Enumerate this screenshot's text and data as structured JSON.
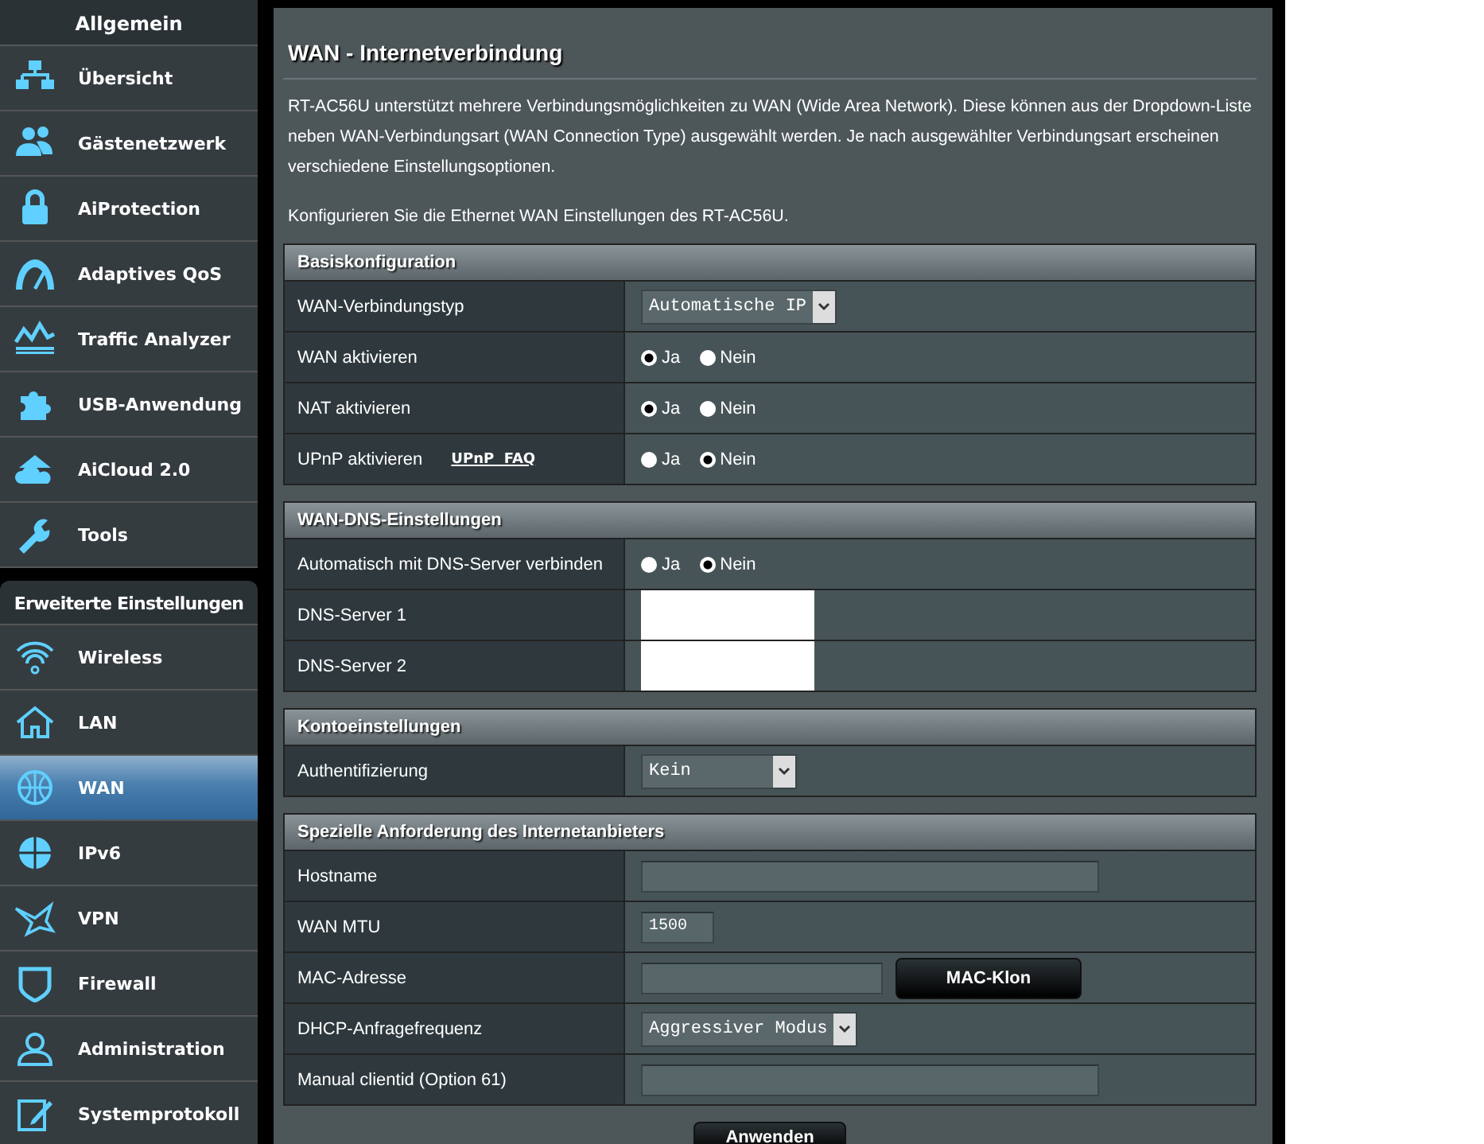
{
  "sidebar": {
    "groups": [
      {
        "title": "Allgemein",
        "items": [
          {
            "label": "Übersicht",
            "selected": false
          },
          {
            "label": "Gästenetzwerk",
            "selected": false
          },
          {
            "label": "AiProtection",
            "selected": false
          },
          {
            "label": "Adaptives QoS",
            "selected": false
          },
          {
            "label": "Traffic Analyzer",
            "selected": false
          },
          {
            "label": "USB-Anwendung",
            "selected": false
          },
          {
            "label": "AiCloud 2.0",
            "selected": false
          },
          {
            "label": "Tools",
            "selected": false
          }
        ]
      },
      {
        "title": "Erweiterte Einstellungen",
        "items": [
          {
            "label": "Wireless",
            "selected": false
          },
          {
            "label": "LAN",
            "selected": false
          },
          {
            "label": "WAN",
            "selected": true
          },
          {
            "label": "IPv6",
            "selected": false
          },
          {
            "label": "VPN",
            "selected": false
          },
          {
            "label": "Firewall",
            "selected": false
          },
          {
            "label": "Administration",
            "selected": false
          },
          {
            "label": "Systemprotokoll",
            "selected": false
          }
        ]
      }
    ]
  },
  "page": {
    "title": "WAN - Internetverbindung",
    "description": "RT-AC56U unterstützt mehrere Verbindungsmöglichkeiten zu WAN (Wide Area Network). Diese können aus der Dropdown-Liste neben WAN-Verbindungsart (WAN Connection Type) ausgewählt werden. Je nach ausgewählter Verbindungsart erscheinen verschiedene Einstellungsoptionen.",
    "note": "Konfigurieren Sie die Ethernet WAN Einstellungen des RT-AC56U.",
    "sections": [
      {
        "title": "Basiskonfiguration",
        "rows": [
          {
            "label": "WAN-Verbindungstyp",
            "kind": "select",
            "value": "Automatische IP"
          },
          {
            "label": "WAN aktivieren",
            "kind": "radio",
            "options": [
              {
                "label": "Ja",
                "selected": true
              },
              {
                "label": "Nein",
                "selected": false
              }
            ]
          },
          {
            "label": "NAT aktivieren",
            "kind": "radio",
            "options": [
              {
                "label": "Ja",
                "selected": true
              },
              {
                "label": "Nein",
                "selected": false
              }
            ]
          },
          {
            "label": "UPnP aktivieren",
            "link": "UPnP  FAQ",
            "kind": "radio",
            "options": [
              {
                "label": "Ja",
                "selected": false
              },
              {
                "label": "Nein",
                "selected": true
              }
            ]
          }
        ]
      },
      {
        "title": "WAN-DNS-Einstellungen",
        "rows": [
          {
            "label": "Automatisch mit DNS-Server verbinden",
            "kind": "radio",
            "options": [
              {
                "label": "Ja",
                "selected": false
              },
              {
                "label": "Nein",
                "selected": true
              }
            ]
          },
          {
            "label": "DNS-Server 1",
            "kind": "blank"
          },
          {
            "label": "DNS-Server 2",
            "kind": "blank"
          }
        ]
      },
      {
        "title": "Kontoeinstellungen",
        "rows": [
          {
            "label": "Authentifizierung",
            "kind": "select",
            "value": "Kein"
          }
        ]
      },
      {
        "title": "Spezielle Anforderung des Internetanbieters",
        "rows": [
          {
            "label": "Hostname",
            "kind": "text"
          },
          {
            "label": "WAN MTU",
            "kind": "text",
            "value": "1500"
          },
          {
            "label": "MAC-Adresse",
            "kind": "text",
            "button": "MAC-Klon"
          },
          {
            "label": "DHCP-Anfragefrequenz",
            "kind": "select",
            "value": "Aggressiver Modus"
          },
          {
            "label": "Manual clientid (Option 61)",
            "kind": "text"
          }
        ]
      }
    ],
    "apply_button": "Anwenden"
  }
}
